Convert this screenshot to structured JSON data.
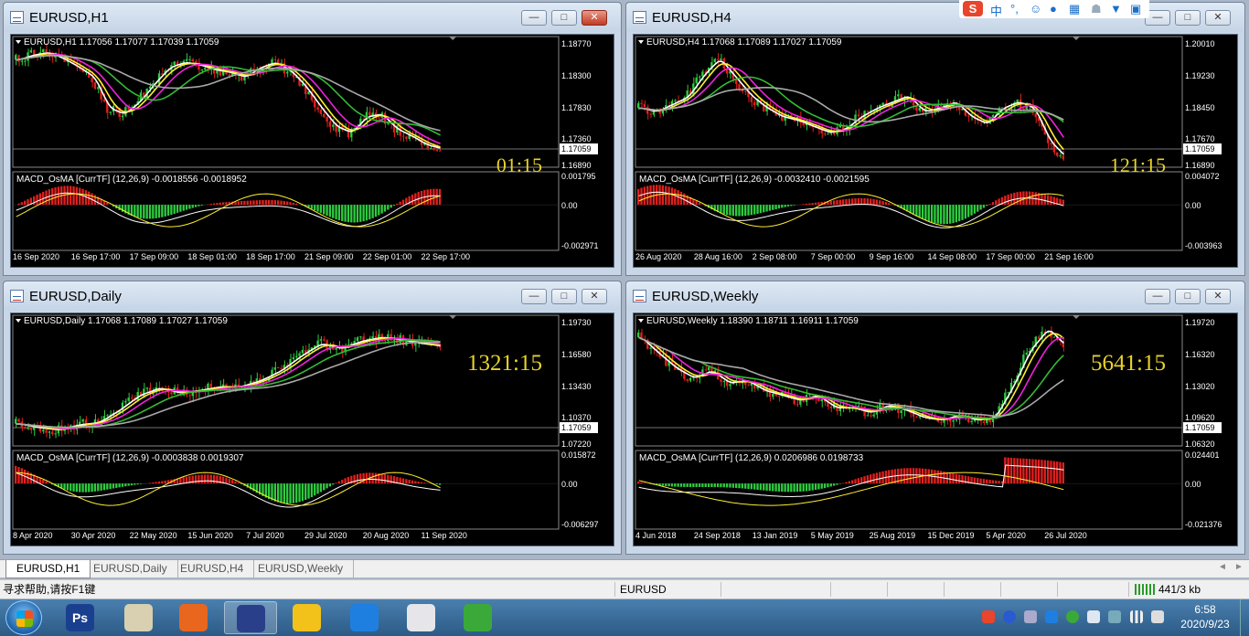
{
  "windows": [
    {
      "id": "h1",
      "title": "EURUSD,H1",
      "header": "EURUSD,H1  1.17056 1.17077 1.17039 1.17059",
      "price_labels": [
        "1.18770",
        "1.18300",
        "1.17830",
        "1.17360",
        "1.16890"
      ],
      "current_price": "1.17059",
      "countdown": "01:15",
      "osc_header": "MACD_OsMA [CurrTF] (12,26,9) -0.0018556 -0.0018952",
      "osc_labels": [
        "0.001795",
        "0.00",
        "-0.002971"
      ],
      "time_labels": [
        "16 Sep 2020",
        "16 Sep 17:00",
        "17 Sep 09:00",
        "18 Sep 01:00",
        "18 Sep 17:00",
        "21 Sep 09:00",
        "22 Sep 01:00",
        "22 Sep 17:00"
      ],
      "close_button_active": true
    },
    {
      "id": "h4",
      "title": "EURUSD,H4",
      "header": "EURUSD,H4  1.17068 1.17089 1.17027 1.17059",
      "price_labels": [
        "1.20010",
        "1.19230",
        "1.18450",
        "1.17670",
        "1.16890"
      ],
      "current_price": "1.17059",
      "countdown": "121:15",
      "osc_header": "MACD_OsMA [CurrTF] (12,26,9) -0.0032410 -0.0021595",
      "osc_labels": [
        "0.004072",
        "0.00",
        "-0.003963"
      ],
      "time_labels": [
        "26 Aug 2020",
        "28 Aug 16:00",
        "2 Sep 08:00",
        "7 Sep 00:00",
        "9 Sep 16:00",
        "14 Sep 08:00",
        "17 Sep 00:00",
        "21 Sep 16:00"
      ],
      "close_button_active": false
    },
    {
      "id": "daily",
      "title": "EURUSD,Daily",
      "header": "EURUSD,Daily  1.17068 1.17089 1.17027 1.17059",
      "price_labels": [
        "1.19730",
        "1.16580",
        "1.13430",
        "1.10370",
        "1.07220"
      ],
      "current_price": "1.17059",
      "countdown": "1321:15",
      "osc_header": "MACD_OsMA [CurrTF] (12,26,9) -0.0003838 0.0019307",
      "osc_labels": [
        "0.015872",
        "0.00",
        "-0.006297"
      ],
      "time_labels": [
        "8 Apr 2020",
        "30 Apr 2020",
        "22 May 2020",
        "15 Jun 2020",
        "7 Jul 2020",
        "29 Jul 2020",
        "20 Aug 2020",
        "11 Sep 2020"
      ],
      "close_button_active": false
    },
    {
      "id": "weekly",
      "title": "EURUSD,Weekly",
      "header": "EURUSD,Weekly  1.18390 1.18711 1.16911 1.17059",
      "price_labels": [
        "1.19720",
        "1.16320",
        "1.13020",
        "1.09620",
        "1.06320"
      ],
      "current_price": "1.17059",
      "countdown": "5641:15",
      "osc_header": "MACD_OsMA [CurrTF] (12,26,9) 0.0206986 0.0198733",
      "osc_labels": [
        "0.024401",
        "0.00",
        "-0.021376"
      ],
      "time_labels": [
        "4 Jun 2018",
        "24 Sep 2018",
        "13 Jan 2019",
        "5 May 2019",
        "25 Aug 2019",
        "15 Dec 2019",
        "5 Apr 2020",
        "26 Jul 2020"
      ],
      "close_button_active": false
    }
  ],
  "tabs": [
    "EURUSD,H1",
    "EURUSD,Daily",
    "EURUSD,H4",
    "EURUSD,Weekly"
  ],
  "active_tab": 0,
  "status": {
    "help": "寻求帮助,请按F1键",
    "symbol": "EURUSD",
    "traffic": "441/3 kb"
  },
  "taskbar": {
    "apps": [
      {
        "icon": "photoshop-icon",
        "label": "Ps",
        "color": "#1a3f8f"
      },
      {
        "icon": "maps-icon",
        "label": "",
        "color": "#d8d0b0"
      },
      {
        "icon": "firefox-icon",
        "label": "",
        "color": "#e8661e"
      },
      {
        "icon": "uk-flag-icon",
        "label": "",
        "color": "#2a3f8a"
      },
      {
        "icon": "smiley-icon",
        "label": "",
        "color": "#f2c21a"
      },
      {
        "icon": "feather-icon",
        "label": "",
        "color": "#1e7fe0"
      },
      {
        "icon": "document-icon",
        "label": "",
        "color": "#e6e6ea"
      },
      {
        "icon": "wechat-icon",
        "label": "",
        "color": "#3aa93a"
      }
    ],
    "time": "6:58",
    "date": "2020/9/23"
  },
  "ime": {
    "lang": "中"
  },
  "colors": {
    "bull": "#2ecc40",
    "bear": "#e0201e",
    "ma_white": "#ffffff",
    "ma_yellow": "#ffee33",
    "ma_magenta": "#ee22dd",
    "ma_green": "#33bb33",
    "ma_gray": "#a8a8a8",
    "countdown": "#e8d22a"
  }
}
